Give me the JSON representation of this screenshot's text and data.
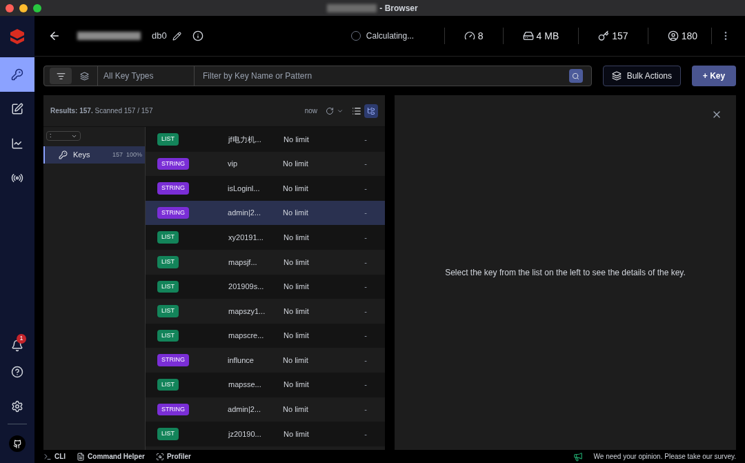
{
  "window": {
    "title": "- Browser"
  },
  "sidebar": {
    "items": [
      {
        "kind": "keys",
        "selected": true
      },
      {
        "kind": "workbench",
        "selected": false
      },
      {
        "kind": "analytics",
        "selected": false
      },
      {
        "kind": "pubsub",
        "selected": false
      }
    ],
    "notifications_badge": "1"
  },
  "header": {
    "database": "db0",
    "status": "Calculating...",
    "stats": [
      {
        "kind": "ops",
        "value": "8"
      },
      {
        "kind": "memory",
        "value": "4 MB"
      },
      {
        "kind": "keys",
        "value": "157"
      },
      {
        "kind": "clients",
        "value": "180"
      }
    ]
  },
  "filter": {
    "key_type": "All Key Types",
    "placeholder": "Filter by Key Name or Pattern",
    "bulk_actions": "Bulk Actions",
    "add_key": "+ Key"
  },
  "results": {
    "summary_bold": "Results: 157.",
    "summary": "Scanned 157 / 157",
    "refreshed": "now"
  },
  "tree": {
    "delimiter": ":",
    "items": [
      {
        "label": "Keys",
        "count": "157",
        "percent": "100%",
        "selected": true
      }
    ]
  },
  "keys": [
    {
      "type": "LIST",
      "kind": "list",
      "name": "jf电力机...",
      "ttl": "No limit",
      "size": "-",
      "selected": false
    },
    {
      "type": "STRING",
      "kind": "string",
      "name": "vip",
      "ttl": "No limit",
      "size": "-",
      "selected": false
    },
    {
      "type": "STRING",
      "kind": "string",
      "name": "isLoginl...",
      "ttl": "No limit",
      "size": "-",
      "selected": false
    },
    {
      "type": "STRING",
      "kind": "string",
      "name": "admin|2...",
      "ttl": "No limit",
      "size": "-",
      "selected": true
    },
    {
      "type": "LIST",
      "kind": "list",
      "name": "xy20191...",
      "ttl": "No limit",
      "size": "-",
      "selected": false
    },
    {
      "type": "LIST",
      "kind": "list",
      "name": "mapsjf...",
      "ttl": "No limit",
      "size": "-",
      "selected": false
    },
    {
      "type": "LIST",
      "kind": "list",
      "name": "201909s...",
      "ttl": "No limit",
      "size": "-",
      "selected": false
    },
    {
      "type": "LIST",
      "kind": "list",
      "name": "mapszy1...",
      "ttl": "No limit",
      "size": "-",
      "selected": false
    },
    {
      "type": "LIST",
      "kind": "list",
      "name": "mapscre...",
      "ttl": "No limit",
      "size": "-",
      "selected": false
    },
    {
      "type": "STRING",
      "kind": "string",
      "name": "influnce",
      "ttl": "No limit",
      "size": "-",
      "selected": false
    },
    {
      "type": "LIST",
      "kind": "list",
      "name": "mapsse...",
      "ttl": "No limit",
      "size": "-",
      "selected": false
    },
    {
      "type": "STRING",
      "kind": "string",
      "name": "admin|2...",
      "ttl": "No limit",
      "size": "-",
      "selected": false
    },
    {
      "type": "LIST",
      "kind": "list",
      "name": "jz20190...",
      "ttl": "No limit",
      "size": "-",
      "selected": false
    }
  ],
  "details": {
    "message": "Select the key from the list on the left to see the details of the key."
  },
  "bottom_bar": {
    "items": [
      {
        "kind": "cli",
        "label": "CLI"
      },
      {
        "kind": "helper",
        "label": "Command Helper"
      },
      {
        "kind": "profiler",
        "label": "Profiler"
      }
    ],
    "survey": "We need your opinion. Please take our survey."
  }
}
